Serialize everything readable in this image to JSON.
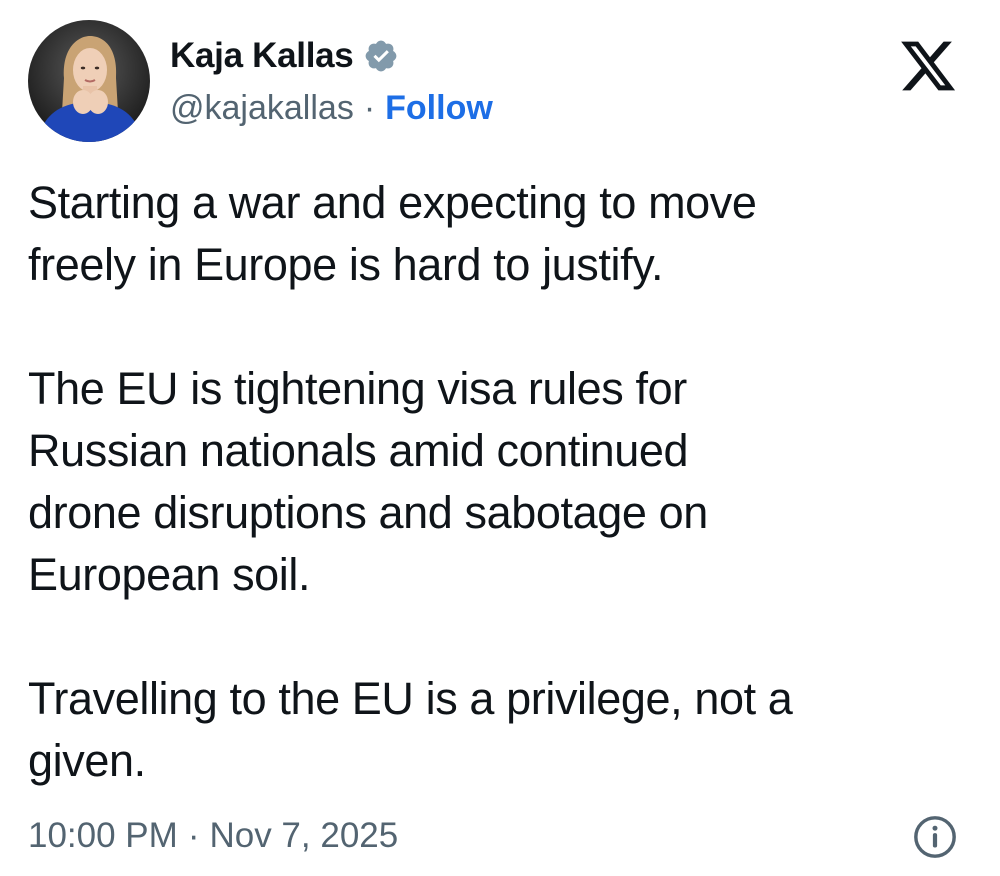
{
  "author": {
    "display_name": "Kaja Kallas",
    "handle": "@kajakallas",
    "separator": "·",
    "follow_label": "Follow",
    "verified_icon": "verified-badge-icon",
    "verified_color": "#829aab"
  },
  "brand": {
    "logo_icon": "x-logo-icon"
  },
  "tweet": {
    "paragraphs": [
      "Starting a war and expecting to move\nfreely in Europe is hard to justify.",
      "The EU is tightening visa rules for\nRussian nationals amid continued\ndrone disruptions and sabotage on\nEuropean soil.",
      "Travelling to the EU is a privilege, not a\ngiven."
    ]
  },
  "meta": {
    "time": "10:00 PM",
    "separator": "·",
    "date": "Nov 7, 2025",
    "info_icon": "info-icon"
  },
  "colors": {
    "text": "#0f1419",
    "secondary": "#536471",
    "follow": "#1d6ee6"
  }
}
